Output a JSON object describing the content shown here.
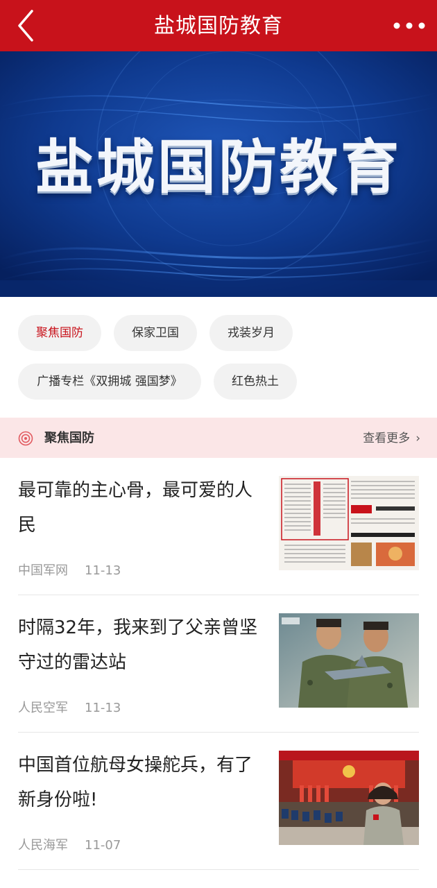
{
  "header": {
    "title": "盐城国防教育"
  },
  "banner": {
    "title": "盐城国防教育"
  },
  "chips": [
    {
      "label": "聚焦国防",
      "active": true
    },
    {
      "label": "保家卫国",
      "active": false
    },
    {
      "label": "戎装岁月",
      "active": false
    },
    {
      "label": "广播专栏《双拥城 强国梦》",
      "active": false
    },
    {
      "label": "红色热土",
      "active": false
    }
  ],
  "section": {
    "title": "聚焦国防",
    "more": "查看更多"
  },
  "articles": [
    {
      "title": "最可靠的主心骨，最可爱的人民",
      "source": "中国军网",
      "date": "11-13"
    },
    {
      "title": "时隔32年，我来到了父亲曾坚守过的雷达站",
      "source": "人民空军",
      "date": "11-13"
    },
    {
      "title": "中国首位航母女操舵兵，有了新身份啦!",
      "source": "人民海军",
      "date": "11-07"
    }
  ],
  "colors": {
    "header_bg": "#c8121b",
    "accent": "#c8121b",
    "section_bg": "#fbe6e7",
    "chip_bg": "#f2f2f2"
  },
  "icons": {
    "back": "chevron-left-icon",
    "more": "ellipsis-icon",
    "section": "target-icon",
    "more_link": "chevron-right-icon"
  }
}
